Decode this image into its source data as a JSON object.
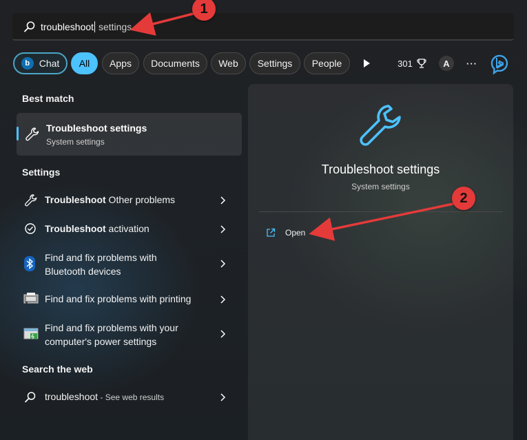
{
  "search": {
    "typed": "troubleshoot",
    "suggestion": " settings"
  },
  "filters": {
    "chat": "Chat",
    "all": "All",
    "apps": "Apps",
    "documents": "Documents",
    "web": "Web",
    "settings": "Settings",
    "people": "People",
    "points": "301",
    "avatar_letter": "A",
    "more": "···"
  },
  "best_match": {
    "header": "Best match",
    "title": "Troubleshoot settings",
    "subtitle": "System settings"
  },
  "settings_section": {
    "header": "Settings",
    "items": [
      {
        "bold": "Troubleshoot",
        "rest": " Other problems",
        "icon": "wrench-icon"
      },
      {
        "bold": "Troubleshoot",
        "rest": " activation",
        "icon": "check-circle-icon"
      },
      {
        "line1": "Find and fix problems with",
        "line2": "Bluetooth devices",
        "icon": "bluetooth-icon"
      },
      {
        "line1": "Find and fix problems with printing",
        "icon": "printer-icon"
      },
      {
        "line1": "Find and fix problems with your",
        "line2": "computer's power settings",
        "icon": "power-icon"
      }
    ]
  },
  "web_section": {
    "header": "Search the web",
    "query": "troubleshoot",
    "suffix": " - See web results"
  },
  "detail": {
    "title": "Troubleshoot settings",
    "subtitle": "System settings",
    "open_label": "Open"
  },
  "annotations": {
    "one": "1",
    "two": "2"
  },
  "colors": {
    "accent": "#4cc2ff",
    "annotation": "#e53a3a"
  }
}
